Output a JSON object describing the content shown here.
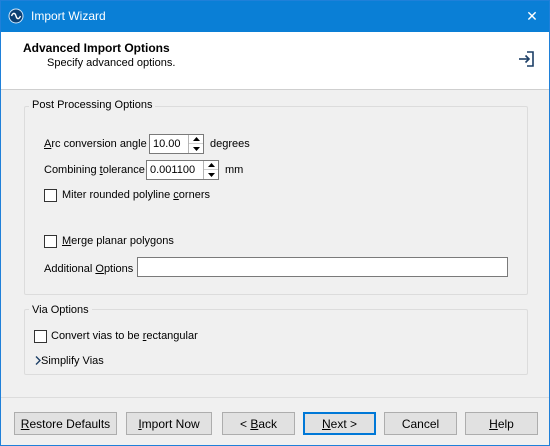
{
  "window": {
    "title": "Import Wizard",
    "close_glyph": "✕"
  },
  "header": {
    "title": "Advanced Import Options",
    "subtitle": "Specify advanced options.",
    "icon": "import-icon"
  },
  "post_processing": {
    "legend": "Post Processing Options",
    "arc_label": {
      "pre": "",
      "acc": "A",
      "post": "rc conversion angle"
    },
    "arc_value": "10.00",
    "arc_unit": "degrees",
    "tol_label": {
      "pre": "Combining ",
      "acc": "t",
      "post": "olerance"
    },
    "tol_value": "0.001100",
    "tol_unit": "mm",
    "miter_label": {
      "pre": "Miter rounded polyline ",
      "acc": "c",
      "post": "orners"
    },
    "miter_checked": false,
    "merge_label": {
      "pre": "",
      "acc": "M",
      "post": "erge planar polygons"
    },
    "merge_checked": false,
    "additional_label": {
      "pre": "Additional ",
      "acc": "O",
      "post": "ptions"
    },
    "additional_value": ""
  },
  "via_options": {
    "legend": "Via Options",
    "convert_label": {
      "pre": "Convert vias to be ",
      "acc": "r",
      "post": "ectangular"
    },
    "convert_checked": false,
    "simplify_label": "Simplify Vias"
  },
  "buttons": {
    "restore": {
      "pre": "",
      "acc": "R",
      "post": "estore Defaults"
    },
    "import_now": {
      "pre": "",
      "acc": "I",
      "post": "mport Now"
    },
    "back": {
      "pre": "< ",
      "acc": "B",
      "post": "ack"
    },
    "next": {
      "pre": "",
      "acc": "N",
      "post": "ext >"
    },
    "cancel": {
      "pre": "Cancel",
      "acc": "",
      "post": ""
    },
    "help": {
      "pre": "",
      "acc": "H",
      "post": "elp"
    }
  },
  "colors": {
    "titlebar": "#0a7fd6",
    "default_button_border": "#0078d7"
  }
}
